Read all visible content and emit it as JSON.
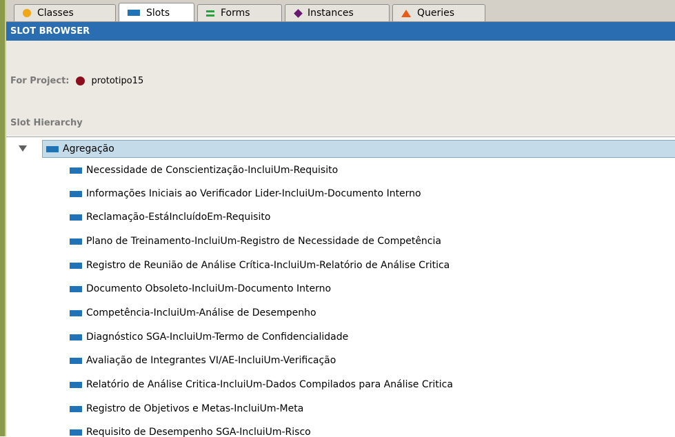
{
  "tabs": [
    {
      "label": "Classes",
      "icon": "classes-icon",
      "active": false
    },
    {
      "label": "Slots",
      "icon": "slots-icon",
      "active": true
    },
    {
      "label": "Forms",
      "icon": "forms-icon",
      "active": false
    },
    {
      "label": "Instances",
      "icon": "instances-icon",
      "active": false
    },
    {
      "label": "Queries",
      "icon": "queries-icon",
      "active": false
    }
  ],
  "header": {
    "title": "SLOT BROWSER"
  },
  "project": {
    "label": "For Project:",
    "name": "prototipo15"
  },
  "hierarchy": {
    "title": "Slot Hierarchy",
    "root": "Agregação",
    "children": [
      "Necessidade de Conscientização-IncluiUm-Requisito",
      "Informações Iniciais ao Verificador Lider-IncluiUm-Documento Interno",
      "Reclamação-EstáIncluídoEm-Requisito",
      "Plano de Treinamento-IncluiUm-Registro de Necessidade de Competência",
      "Registro de Reunião de Análise Crítica-IncluiUm-Relatório de Análise Critica",
      "Documento Obsoleto-IncluiUm-Documento Interno",
      "Competência-IncluiUm-Análise de Desempenho",
      "Diagnóstico SGA-IncluiUm-Termo de Confidencialidade",
      "Avaliação de Integrantes VI/AE-IncluiUm-Verificação",
      "Relatório de Análise Critica-IncluiUm-Dados Compilados para Análise Critica",
      "Registro de Objetivos e Metas-IncluiUm-Meta",
      "Requisito de Desempenho SGA-IncluiUm-Risco"
    ]
  },
  "colors": {
    "header": "#2a6db0",
    "slot_icon": "#1f73b6",
    "selection": "#c4dbe9"
  }
}
